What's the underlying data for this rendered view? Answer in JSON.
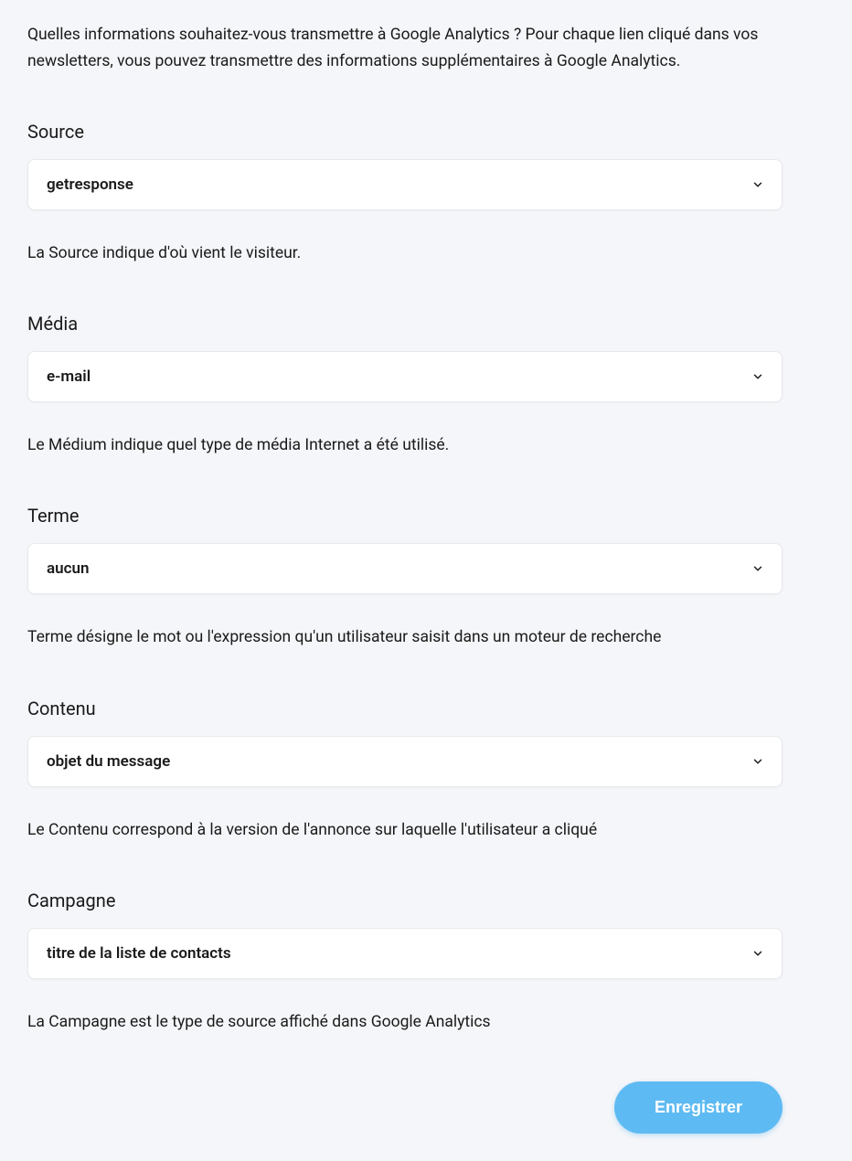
{
  "intro": "Quelles informations souhaitez-vous transmettre à Google Analytics ? Pour chaque lien cliqué dans vos newsletters, vous pouvez transmettre des informations supplémentaires à Google Analytics.",
  "fields": {
    "source": {
      "label": "Source",
      "value": "getresponse",
      "description": "La Source indique d'où vient le visiteur."
    },
    "media": {
      "label": "Média",
      "value": "e-mail",
      "description": "Le Médium indique quel type de média Internet a été utilisé."
    },
    "term": {
      "label": "Terme",
      "value": "aucun",
      "description": "Terme désigne le mot ou l'expression qu'un utilisateur saisit dans un moteur de recherche"
    },
    "content": {
      "label": "Contenu",
      "value": "objet du message",
      "description": "Le Contenu correspond à la version de l'annonce sur laquelle l'utilisateur a cliqué"
    },
    "campaign": {
      "label": "Campagne",
      "value": "titre de la liste de contacts",
      "description": "La Campagne est le type de source affiché dans Google Analytics"
    }
  },
  "actions": {
    "save_label": "Enregistrer"
  }
}
